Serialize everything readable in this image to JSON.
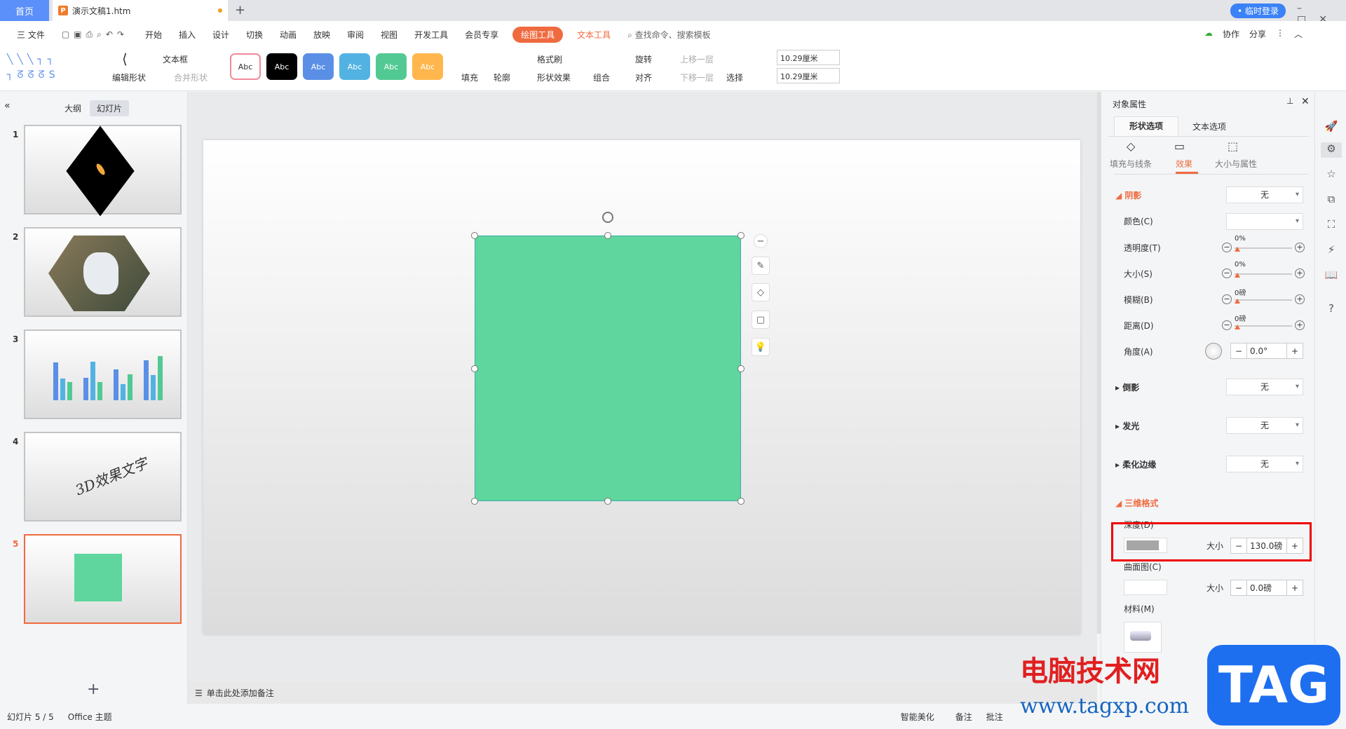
{
  "titlebar": {
    "home": "首页",
    "doc_title": "演示文稿1.htm",
    "login": "• 临时登录"
  },
  "menubar": {
    "file": "三 文件",
    "tabs": [
      "开始",
      "插入",
      "设计",
      "切换",
      "动画",
      "放映",
      "审阅",
      "视图",
      "开发工具",
      "会员专享"
    ],
    "drawing_tools": "绘图工具",
    "text_tools": "文本工具",
    "search": "查找命令、搜索模板",
    "collab": "协作",
    "share": "分享"
  },
  "toolbar": {
    "edit_shape": "编辑形状",
    "textbox": "文本框",
    "merge_shape": "合并形状",
    "style_label": "Abc",
    "fill": "填充",
    "outline": "轮廓",
    "format_painter": "格式刷",
    "shape_effects": "形状效果",
    "group": "组合",
    "rotate": "旋转",
    "align": "对齐",
    "bring_forward": "上移一层",
    "send_backward": "下移一层",
    "select": "选择",
    "height": "10.29厘米",
    "width": "10.29厘米"
  },
  "style_colors": [
    "#ffffff",
    "#000000",
    "#5b8fe6",
    "#52b3e3",
    "#52c993",
    "#ffb74d"
  ],
  "leftpanel": {
    "outline_tab": "大纲",
    "slides_tab": "幻灯片",
    "slide3_wordart": "3D效果文字",
    "slides": [
      "1",
      "2",
      "3",
      "4",
      "5"
    ]
  },
  "notes": {
    "placeholder": "单击此处添加备注"
  },
  "statusbar": {
    "slide_count": "幻灯片 5 / 5",
    "theme": "Office 主题",
    "beautify": "智能美化",
    "notes": "备注",
    "comments": "批注"
  },
  "rpanel": {
    "title": "对象属性",
    "tab_shape": "形状选项",
    "tab_text": "文本选项",
    "sub_fill": "填充与线条",
    "sub_effect": "效果",
    "sub_size": "大小与属性",
    "shadow": "阴影",
    "none": "无",
    "color": "颜色(C)",
    "transparency": "透明度(T)",
    "size": "大小(S)",
    "blur": "模糊(B)",
    "distance": "距离(D)",
    "angle": "角度(A)",
    "transparency_val": "0%",
    "size_val": "0%",
    "blur_val": "0磅",
    "distance_val": "0磅",
    "angle_val": "0.0°",
    "reflection": "倒影",
    "glow": "发光",
    "soft_edges": "柔化边缘",
    "format3d": "三维格式",
    "depth": "深度(D)",
    "size_label": "大小",
    "depth_val": "130.0磅",
    "contour": "曲面图(C)",
    "contour_val": "0.0磅",
    "material": "材料(M)",
    "minus": "−",
    "plus": "+"
  },
  "watermark": {
    "site": "电脑技术网",
    "url": "www.tagxp.com",
    "tag": "TAG"
  },
  "colors": {
    "accent": "#ef6b3f",
    "shape_fill": "#5ed69d",
    "home_tab": "#5b8ff9"
  }
}
